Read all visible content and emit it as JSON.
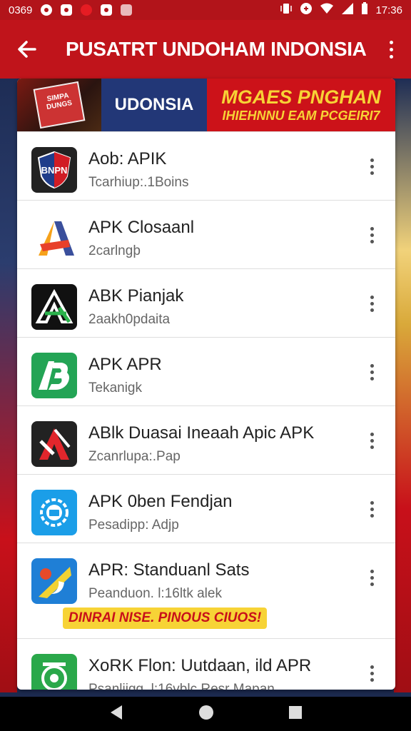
{
  "status_bar": {
    "time_left": "0369",
    "time_right": "17:36"
  },
  "app_bar": {
    "title": "PUSATRT UNDOHAM INDONSIA"
  },
  "banner": {
    "book_text": "SIMPA DUNGS",
    "mid_text": "UDONSIA",
    "headline": "MGAES PNGHAN",
    "subline": "IHIEHNNU EAM PCGEIRI7"
  },
  "apps": [
    {
      "title": "Aob: APIK",
      "subtitle": "Tcarhiup:.1Boins",
      "icon": "shield-icon",
      "icon_text": "BNPN",
      "icon_bg": "#222222"
    },
    {
      "title": "APK Closaanl",
      "subtitle": "2carlngþ",
      "icon": "letter-a-icon",
      "icon_bg": "#ffffff"
    },
    {
      "title": "ABK Pianjak",
      "subtitle": "2aakh0pdaita",
      "icon": "letter-a-outline-icon",
      "icon_bg": "#111111"
    },
    {
      "title": "APK APR",
      "subtitle": "Tekanigk",
      "icon": "letter-b-icon",
      "icon_bg": "#23a455"
    },
    {
      "title": "ABlk Duasai Ineaah Apic APK",
      "subtitle": "Zcanrlupa:.Pap",
      "icon": "letter-a-red-icon",
      "icon_bg": "#222222"
    },
    {
      "title": "APK 0ben Fendjan",
      "subtitle": "Pesadipp: Adjp",
      "icon": "gear-icon",
      "icon_bg": "#1b9ee8"
    },
    {
      "title": "APR: Standuanl Sats",
      "subtitle": "Peanduon. l:16ltk alek",
      "promo": "DINRAI NISE. PINOUS CIUOS!",
      "icon": "moon-icon",
      "icon_bg": "#1f7fd6"
    },
    {
      "title": "XoRK Flon: Uutdaan, ild APR",
      "subtitle": "Psanliigg. l:16vblc Resr Mapan",
      "icon": "circle-icon",
      "icon_bg": "#2aa84a"
    }
  ],
  "colors": {
    "primary": "#c0141b",
    "banner_blue": "#223777",
    "accent_yellow": "#f7d336"
  }
}
